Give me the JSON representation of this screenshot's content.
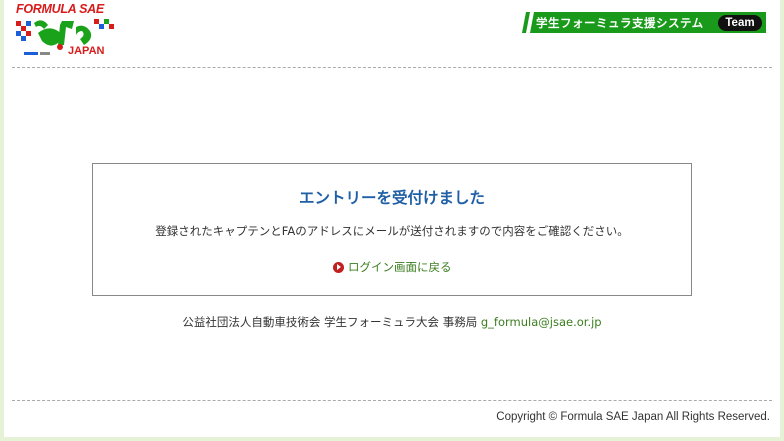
{
  "header": {
    "logo_top": "FORMULA SAE",
    "logo_bottom": "JAPAN",
    "banner_text": "学生フォーミュラ支援システム",
    "badge": "Team"
  },
  "panel": {
    "title": "エントリーを受付けました",
    "message": "登録されたキャプテンとFAのアドレスにメールが送付されますので内容をご確認ください。",
    "login_link": "ログイン画面に戻る"
  },
  "footer": {
    "org": "公益社団法人自動車技術会 学生フォーミュラ大会 事務局 ",
    "email": "g_formula@jsae.or.jp",
    "copyright": "Copyright © Formula SAE Japan All Rights Reserved."
  },
  "colors": {
    "accent_green": "#1a9a1a",
    "title_blue": "#1f5fa6",
    "link_green": "#3a7d1e",
    "logo_red": "#d81b1b"
  }
}
